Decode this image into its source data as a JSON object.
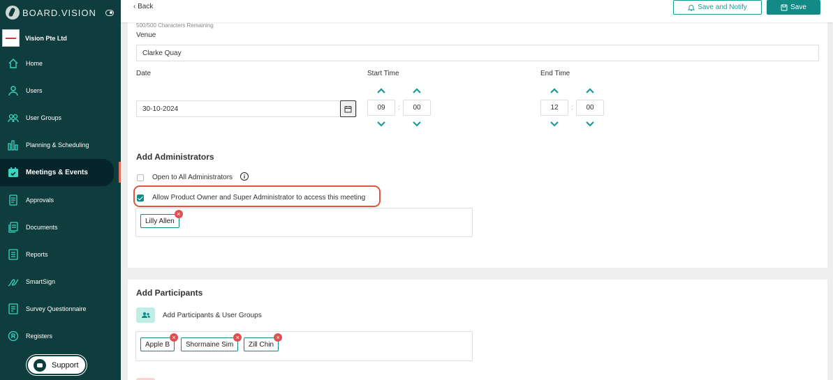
{
  "brand": {
    "name": "BOARD.VISION"
  },
  "organization": {
    "name": "Vision Pte Ltd"
  },
  "sidebar": {
    "items": [
      {
        "label": "Home",
        "icon": "home-icon"
      },
      {
        "label": "Users",
        "icon": "user-icon"
      },
      {
        "label": "User Groups",
        "icon": "user-groups-icon"
      },
      {
        "label": "Planning & Scheduling",
        "icon": "chart-bars-icon"
      },
      {
        "label": "Meetings & Events",
        "icon": "calendar-check-icon",
        "active": true
      },
      {
        "label": "Approvals",
        "icon": "document-check-icon"
      },
      {
        "label": "Documents",
        "icon": "documents-icon"
      },
      {
        "label": "Reports",
        "icon": "report-icon"
      },
      {
        "label": "SmartSign",
        "icon": "signature-icon"
      },
      {
        "label": "Survey Questionnaire",
        "icon": "survey-icon"
      },
      {
        "label": "Registers",
        "icon": "registered-icon"
      }
    ],
    "support_label": "Support"
  },
  "topbar": {
    "back_label": "Back",
    "save_notify_label": "Save and Notify",
    "save_label": "Save"
  },
  "form": {
    "chars_remaining": "500/500 Characters Remaining",
    "venue_label": "Venue",
    "venue_value": "Clarke Quay",
    "date_label": "Date",
    "date_value": "30-10-2024",
    "start_time_label": "Start Time",
    "start_hour": "09",
    "start_minute": "00",
    "end_time_label": "End Time",
    "end_hour": "12",
    "end_minute": "00",
    "time_separator": ":"
  },
  "administrators": {
    "title": "Add Administrators",
    "open_to_all_label": "Open to All Administrators",
    "open_to_all_checked": false,
    "allow_owner_label": "Allow Product Owner and Super Administrator to access this meeting",
    "allow_owner_checked": true,
    "selected": [
      "Lilly Allen"
    ]
  },
  "participants": {
    "title": "Add Participants",
    "add_label": "Add Participants & User Groups",
    "selected": [
      "Apple B",
      "Shormaine Sim",
      "Zill Chin"
    ]
  },
  "colors": {
    "sidebar_bg": "#0f3d3d",
    "accent": "#138a86",
    "highlight": "#e0553e",
    "remove_badge": "#e05050"
  }
}
